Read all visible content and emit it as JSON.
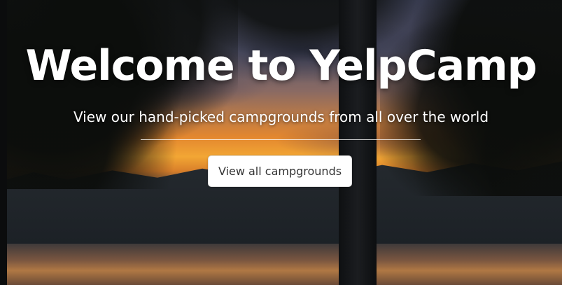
{
  "hero": {
    "title": "Welcome to YelpCamp",
    "subtitle": "View our hand-picked campgrounds from all over the world",
    "cta_label": "View all campgrounds"
  },
  "colors": {
    "title_text": "#ffffff",
    "button_background": "#ffffff",
    "button_text": "#333333",
    "divider": "#ffffff"
  }
}
